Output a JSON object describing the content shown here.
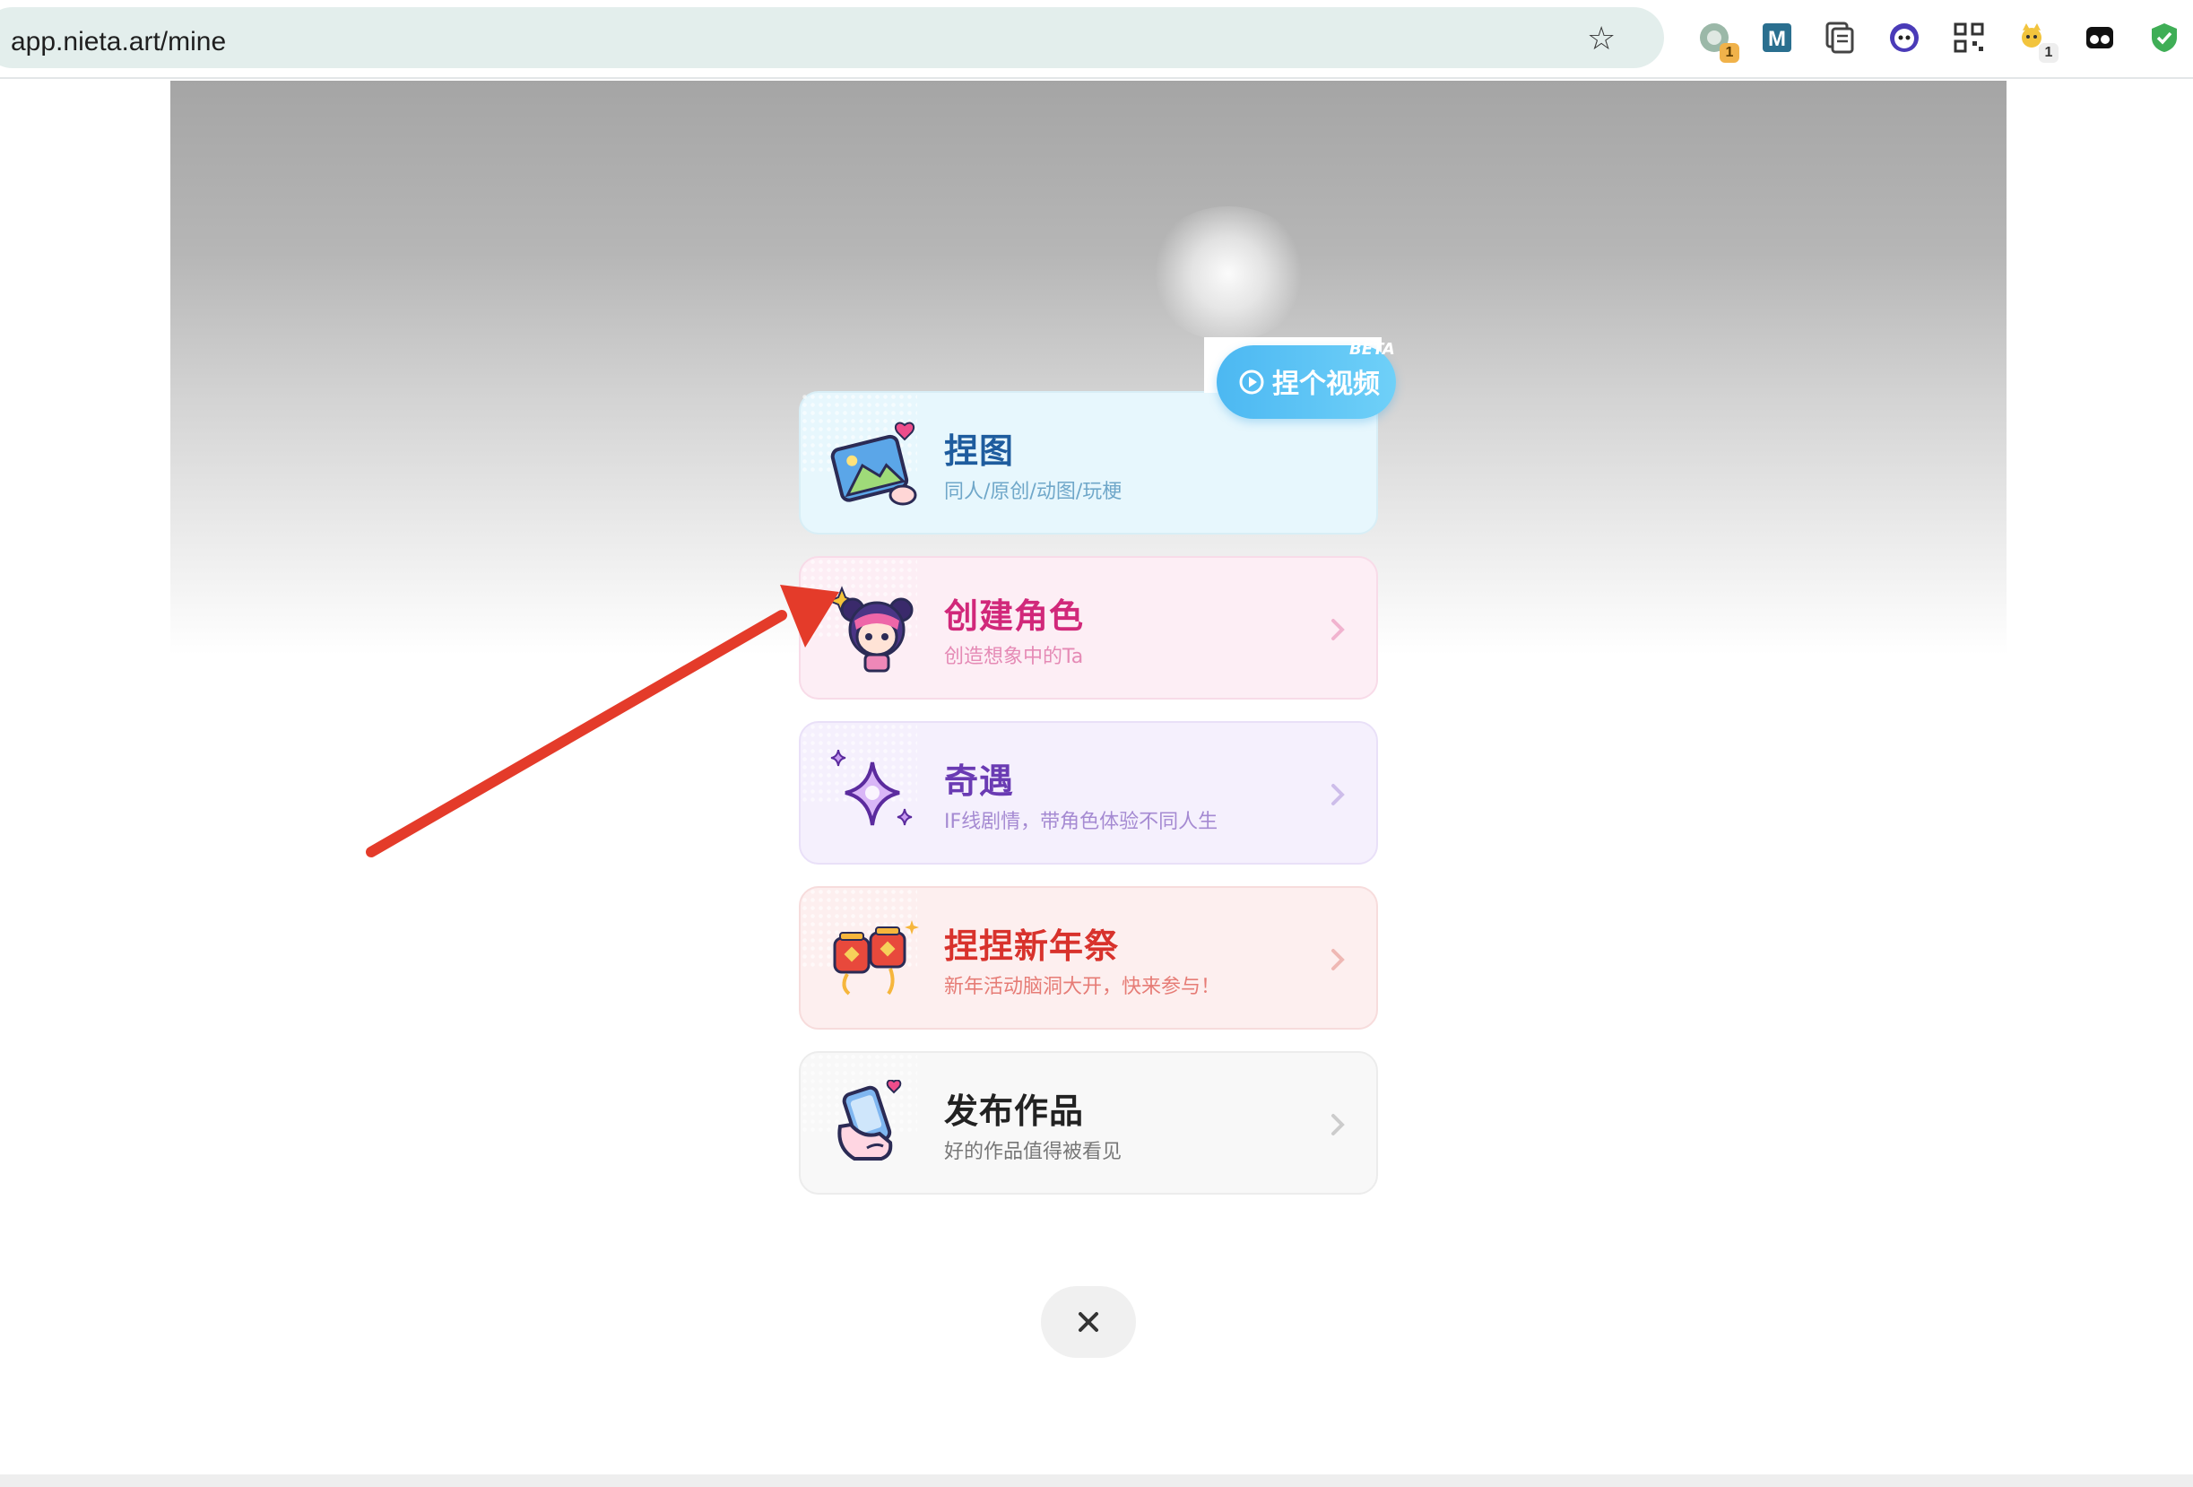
{
  "browser": {
    "url": "app.nieta.art/mine",
    "extensions": [
      {
        "name": "extension-1",
        "badge": "1"
      },
      {
        "name": "extension-m",
        "badge": ""
      },
      {
        "name": "extension-docs",
        "badge": ""
      },
      {
        "name": "extension-face",
        "badge": ""
      },
      {
        "name": "extension-qr",
        "badge": ""
      },
      {
        "name": "extension-cat",
        "badge": "1"
      },
      {
        "name": "extension-mask",
        "badge": ""
      },
      {
        "name": "extension-shield",
        "badge": ""
      }
    ]
  },
  "video_button": {
    "label": "捏个视频",
    "tag": "BETA"
  },
  "menu": [
    {
      "title": "捏图",
      "subtitle": "同人/原创/动图/玩梗",
      "title_color": "#1e5c9e",
      "sub_color": "#6fa7c9"
    },
    {
      "title": "创建角色",
      "subtitle": "创造想象中的Ta",
      "title_color": "#d1287a",
      "sub_color": "#e58ab5"
    },
    {
      "title": "奇遇",
      "subtitle": "IF线剧情，带角色体验不同人生",
      "title_color": "#6a3bb3",
      "sub_color": "#a58ad2"
    },
    {
      "title": "捏捏新年祭",
      "subtitle": "新年活动脑洞大开，快来参与！",
      "title_color": "#d8322c",
      "sub_color": "#e67c76"
    },
    {
      "title": "发布作品",
      "subtitle": "好的作品值得被看见",
      "title_color": "#222222",
      "sub_color": "#777777"
    }
  ],
  "close_label": "×",
  "colors": {
    "accent_blue": "#4cb8f2",
    "arrow_red": "#e43b2a"
  }
}
